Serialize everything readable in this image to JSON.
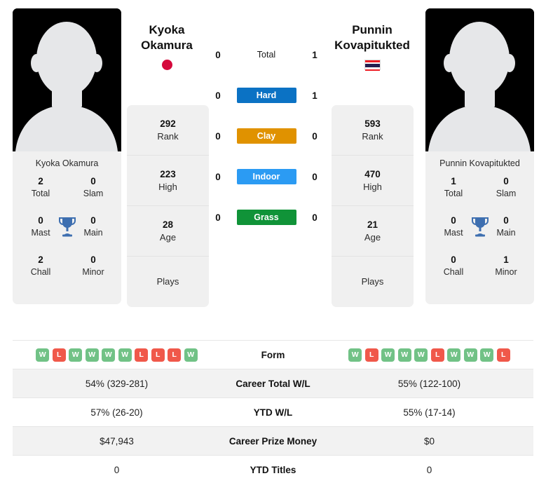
{
  "players": {
    "left": {
      "name": "Kyoka Okamura",
      "first_name": "Kyoka",
      "last_name": "Okamura",
      "flag": "japan-flag",
      "photo": "player-photo-placeholder",
      "titles": {
        "total": {
          "value": "2",
          "label": "Total"
        },
        "slam": {
          "value": "0",
          "label": "Slam"
        },
        "mast": {
          "value": "0",
          "label": "Mast"
        },
        "main": {
          "value": "0",
          "label": "Main"
        },
        "chall": {
          "value": "2",
          "label": "Chall"
        },
        "minor": {
          "value": "0",
          "label": "Minor"
        }
      },
      "stats": {
        "rank": {
          "value": "292",
          "label": "Rank"
        },
        "high": {
          "value": "223",
          "label": "High"
        },
        "age": {
          "value": "28",
          "label": "Age"
        },
        "plays": {
          "value": "",
          "label": "Plays"
        }
      },
      "scores": {
        "total": "0",
        "hard": "0",
        "clay": "0",
        "indoor": "0",
        "grass": "0"
      },
      "form": [
        "W",
        "L",
        "W",
        "W",
        "W",
        "W",
        "L",
        "L",
        "L",
        "W"
      ],
      "career_total_wl": "54% (329-281)",
      "ytd_wl": "57% (26-20)",
      "career_prize_money": "$47,943",
      "ytd_titles": "0"
    },
    "right": {
      "name": "Punnin Kovapitukted",
      "first_name": "Punnin",
      "last_name": "Kovapitukted",
      "flag": "thailand-flag",
      "photo": "player-photo-placeholder",
      "titles": {
        "total": {
          "value": "1",
          "label": "Total"
        },
        "slam": {
          "value": "0",
          "label": "Slam"
        },
        "mast": {
          "value": "0",
          "label": "Mast"
        },
        "main": {
          "value": "0",
          "label": "Main"
        },
        "chall": {
          "value": "0",
          "label": "Chall"
        },
        "minor": {
          "value": "1",
          "label": "Minor"
        }
      },
      "stats": {
        "rank": {
          "value": "593",
          "label": "Rank"
        },
        "high": {
          "value": "470",
          "label": "High"
        },
        "age": {
          "value": "21",
          "label": "Age"
        },
        "plays": {
          "value": "",
          "label": "Plays"
        }
      },
      "scores": {
        "total": "1",
        "hard": "1",
        "clay": "0",
        "indoor": "0",
        "grass": "0"
      },
      "form": [
        "W",
        "L",
        "W",
        "W",
        "W",
        "L",
        "W",
        "W",
        "W",
        "L"
      ],
      "career_total_wl": "55% (122-100)",
      "ytd_wl": "55% (17-14)",
      "career_prize_money": "$0",
      "ytd_titles": "0"
    }
  },
  "surfaces": [
    {
      "key": "total",
      "label": "Total",
      "color": "transparent",
      "text_color": "#1a1a1a"
    },
    {
      "key": "hard",
      "label": "Hard",
      "color": "#0b72c4",
      "text_color": "#ffffff"
    },
    {
      "key": "clay",
      "label": "Clay",
      "color": "#e09200",
      "text_color": "#ffffff"
    },
    {
      "key": "indoor",
      "label": "Indoor",
      "color": "#2b9bf3",
      "text_color": "#ffffff"
    },
    {
      "key": "grass",
      "label": "Grass",
      "color": "#109338",
      "text_color": "#ffffff"
    }
  ],
  "table": {
    "rows": [
      {
        "label": "Form",
        "type": "form"
      },
      {
        "label": "Career Total W/L",
        "type": "text",
        "field": "career_total_wl"
      },
      {
        "label": "YTD W/L",
        "type": "text",
        "field": "ytd_wl"
      },
      {
        "label": "Career Prize Money",
        "type": "text",
        "field": "career_prize_money"
      },
      {
        "label": "YTD Titles",
        "type": "text",
        "field": "ytd_titles"
      }
    ]
  },
  "colors": {
    "win": "#71c286",
    "loss": "#f0584a",
    "trophy": "#3e6fb0",
    "card_bg": "#f0f0f0",
    "row_shaded": "#f2f2f2"
  }
}
